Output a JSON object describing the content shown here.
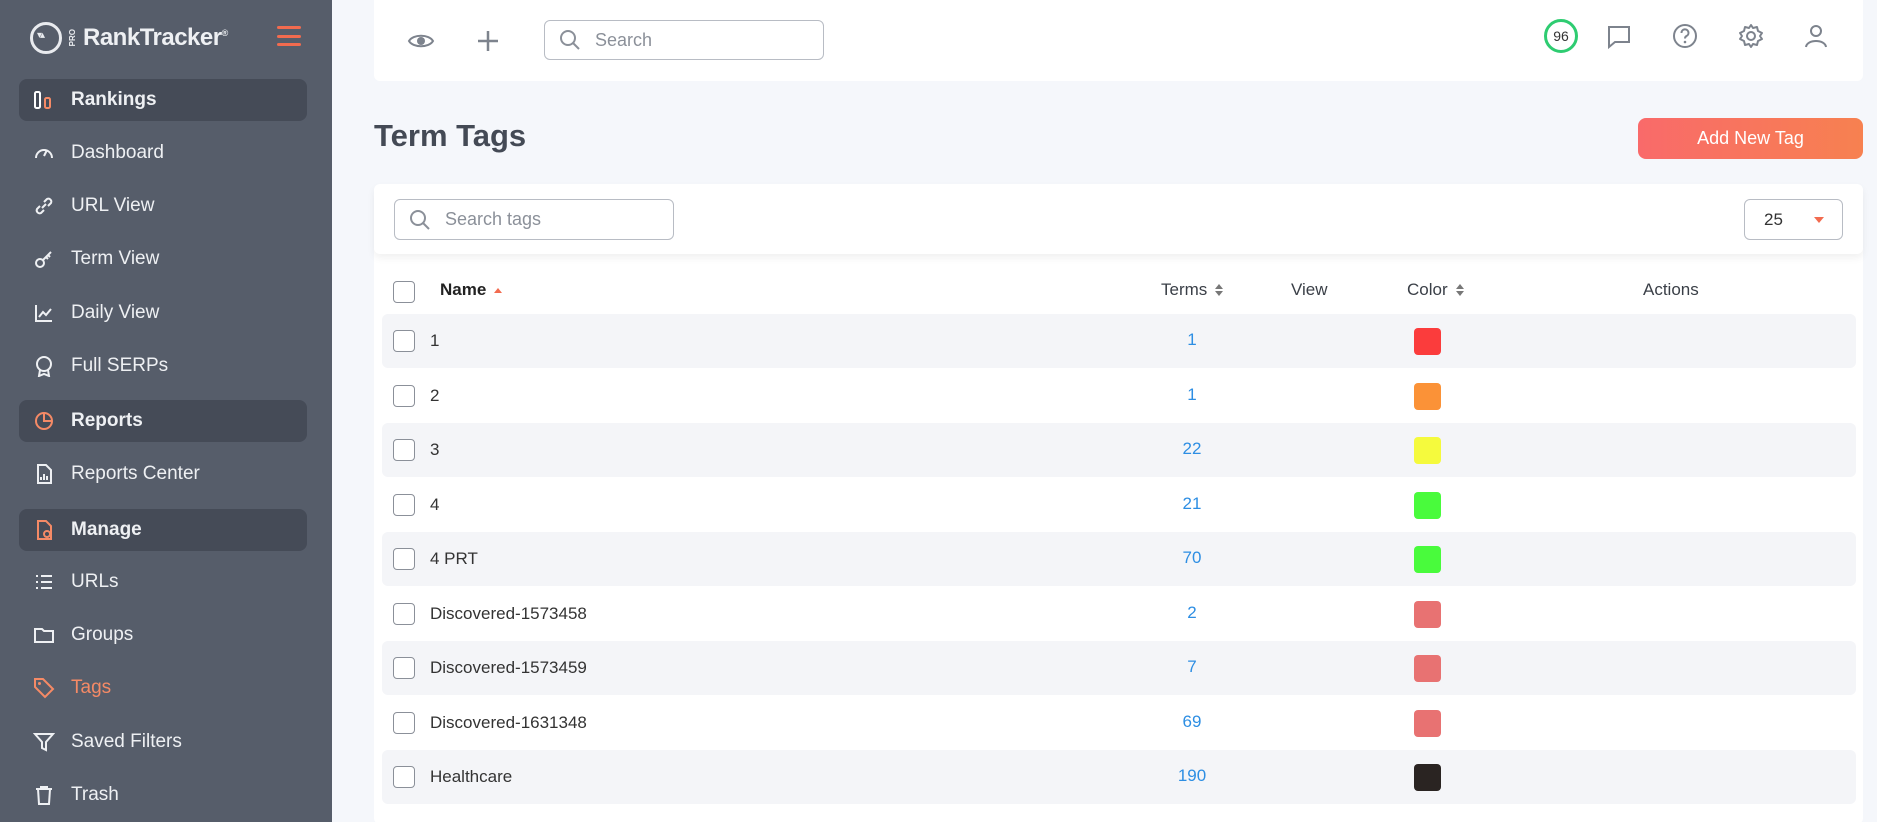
{
  "app": {
    "logo_text": "RankTracker",
    "logo_pro": "PRO",
    "logo_mark": "®"
  },
  "sidebar": {
    "items": [
      {
        "label": "Rankings",
        "type": "section",
        "icon": "rankings-icon"
      },
      {
        "label": "Dashboard",
        "type": "item",
        "icon": "dashboard-icon"
      },
      {
        "label": "URL View",
        "type": "item",
        "icon": "link-icon"
      },
      {
        "label": "Term View",
        "type": "item",
        "icon": "key-icon"
      },
      {
        "label": "Daily View",
        "type": "item",
        "icon": "line-chart-icon"
      },
      {
        "label": "Full SERPs",
        "type": "item",
        "icon": "badge-icon"
      },
      {
        "label": "Reports",
        "type": "section",
        "icon": "pie-chart-icon"
      },
      {
        "label": "Reports Center",
        "type": "item",
        "icon": "report-file-icon"
      },
      {
        "label": "Manage",
        "type": "section",
        "icon": "manage-file-icon"
      },
      {
        "label": "URLs",
        "type": "item",
        "icon": "list-icon"
      },
      {
        "label": "Groups",
        "type": "item",
        "icon": "folder-icon"
      },
      {
        "label": "Tags",
        "type": "item",
        "icon": "tag-icon",
        "active": true
      },
      {
        "label": "Saved Filters",
        "type": "item",
        "icon": "filter-icon"
      },
      {
        "label": "Trash",
        "type": "item",
        "icon": "trash-icon"
      }
    ]
  },
  "topbar": {
    "search_placeholder": "Search",
    "score": "96",
    "score_color": "#2ecc71"
  },
  "page": {
    "title": "Term Tags",
    "add_button": "Add New Tag"
  },
  "table": {
    "search_placeholder": "Search tags",
    "per_page": "25",
    "columns": {
      "name": "Name",
      "terms": "Terms",
      "view": "View",
      "color": "Color",
      "actions": "Actions"
    },
    "rows": [
      {
        "name": "1",
        "terms": "1",
        "color": "#fb3c3c"
      },
      {
        "name": "2",
        "terms": "1",
        "color": "#fb9237"
      },
      {
        "name": "3",
        "terms": "22",
        "color": "#f5fa3d"
      },
      {
        "name": "4",
        "terms": "21",
        "color": "#49fb3c"
      },
      {
        "name": "4 PRT",
        "terms": "70",
        "color": "#49fb3c"
      },
      {
        "name": "Discovered-1573458",
        "terms": "2",
        "color": "#e87272"
      },
      {
        "name": "Discovered-1573459",
        "terms": "7",
        "color": "#e87272"
      },
      {
        "name": "Discovered-1631348",
        "terms": "69",
        "color": "#e87272"
      },
      {
        "name": "Healthcare",
        "terms": "190",
        "color": "#2a2422"
      }
    ]
  },
  "colors": {
    "accent": "#f26b4f",
    "sidebar_bg": "#565d6a",
    "link": "#2d8ee3"
  }
}
